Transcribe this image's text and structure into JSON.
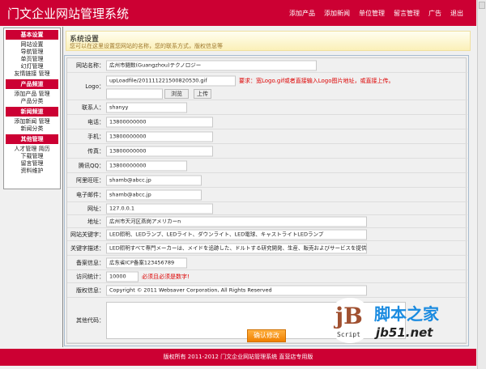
{
  "header": {
    "title": "门文企业网站管理系统",
    "nav": [
      "添加产品",
      "添加新闻",
      "单位管理",
      "留言管理",
      "广告",
      "退出"
    ]
  },
  "sidebar": [
    {
      "heading": "基本设置",
      "items": [
        "网站设置",
        "导航管理",
        "单页管理",
        "幻灯管理",
        "友情链接 管理"
      ]
    },
    {
      "heading": "产品频道",
      "items": [
        "添加产品 管理",
        "产品分类"
      ]
    },
    {
      "heading": "新闻频道",
      "items": [
        "添加新闻 管理",
        "新闻分类"
      ]
    },
    {
      "heading": "其他管理",
      "items": [
        "人才管理 简历",
        "下载管理",
        "留言管理",
        "资料维护"
      ]
    }
  ],
  "page": {
    "title": "系统设置",
    "subtitle": "您可以在这里设置您网站的名称，您的联系方式，版权信息等"
  },
  "form": {
    "rows": [
      {
        "label": "网站名称：",
        "value": "広州市闘数(Guangzhou)テクノロジー"
      },
      {
        "label": "Logo：",
        "value": "upLoadfile/201111221500820530.gif",
        "note": "要求：宽Logo.gif或者直接输入Logo图片地址，或直接上传。",
        "browse": "浏览",
        "upload": "上传"
      },
      {
        "label": "联系人：",
        "value": "shanyy"
      },
      {
        "label": "电话：",
        "value": "13800000000"
      },
      {
        "label": "手机：",
        "value": "13800000000"
      },
      {
        "label": "传真：",
        "value": "13800000000"
      },
      {
        "label": "腾讯QQ：",
        "value": "13800000000"
      },
      {
        "label": "阿里旺旺：",
        "value": "shamb@abcc.jp"
      },
      {
        "label": "电子邮件：",
        "value": "shamb@abcc.jp"
      },
      {
        "label": "网址：",
        "value": "127.0.0.1"
      },
      {
        "label": "地址：",
        "value": "広州市天河区燕岗アメリカーn"
      },
      {
        "label": "网站关键字：",
        "value": "LED照明、LEDランプ、LEDライト、ダウンライト、LED電球、キャストライトLEDランプ"
      },
      {
        "label": "关键字描述：",
        "value": "LED照明すべて専門メーカーは、メイドを追跡した、ドルトする研究開発、生産、販売およびサービスを提供しています。"
      },
      {
        "label": "备案信息：",
        "value": "広东省ICP备案123456789"
      },
      {
        "label": "访问统计：",
        "value": "10000",
        "note": "必须且必须是数字!"
      },
      {
        "label": "版权信息：",
        "value": "Copyright © 2011 Websaver Corporation, All Rights Reserved"
      },
      {
        "label": "其他代码：",
        "value": ""
      }
    ],
    "submit": "确认修改"
  },
  "footer": "版权所有 2011-2012 门文企业网站管理系统 直营店专用版",
  "watermark": {
    "cn": "脚本之家",
    "en": "jb51.net",
    "script": "Script",
    "mark": "jB"
  }
}
